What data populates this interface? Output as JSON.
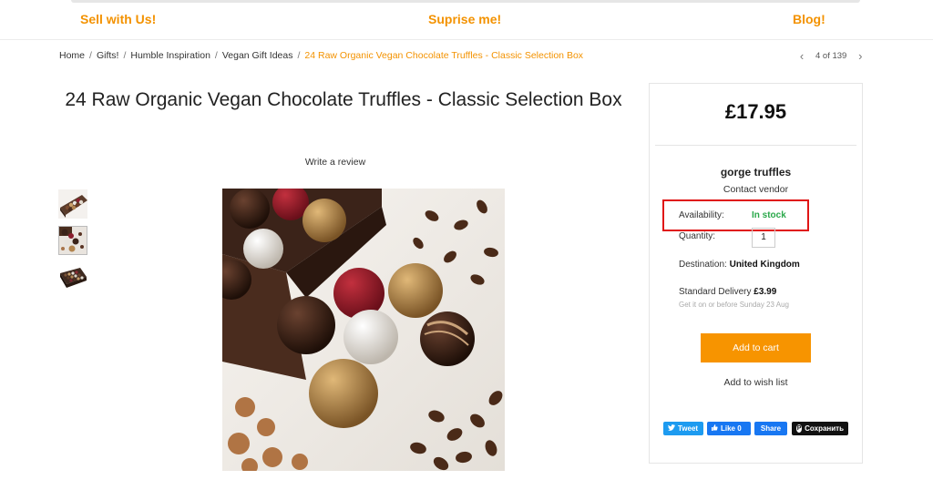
{
  "nav": {
    "sell": "Sell with Us!",
    "surprise": "Suprise me!",
    "blog": "Blog!"
  },
  "breadcrumb": {
    "items": [
      "Home",
      "Gifts!",
      "Humble Inspiration",
      "Vegan Gift Ideas"
    ],
    "separator": "/",
    "current": "24 Raw Organic Vegan Chocolate Truffles - Classic Selection Box"
  },
  "pager": {
    "prev_icon": "chevron-left-icon",
    "next_icon": "chevron-right-icon",
    "prev": "‹",
    "next": "›",
    "count": "4 of 139"
  },
  "product": {
    "title": "24 Raw Organic Vegan Chocolate Truffles - Classic Selection Box",
    "review_link": "Write a review",
    "thumbnail_count": 3
  },
  "panel": {
    "price": "£17.95",
    "vendor": "gorge truffles",
    "contact": "Contact vendor",
    "availability_label": "Availability:",
    "availability_value": "In stock",
    "quantity_label": "Quantity:",
    "quantity_value": "1",
    "destination_label": "Destination:",
    "destination_value": "United Kingdom",
    "delivery_label": "Standard Delivery",
    "delivery_price": "£3.99",
    "delivery_note": "Get it on or before Sunday 23 Aug",
    "add_to_cart": "Add to cart",
    "wish_list": "Add to wish list"
  },
  "share": {
    "tweet": "Tweet",
    "like": "Like 0",
    "share": "Share",
    "save": "Сохранить"
  },
  "colors": {
    "accent": "#f39200",
    "cart_button": "#f79400",
    "in_stock": "#2aa84a",
    "highlight_box": "#e01515",
    "twitter": "#1d9bf0",
    "facebook": "#1877f2",
    "pinterest": "#111111"
  }
}
